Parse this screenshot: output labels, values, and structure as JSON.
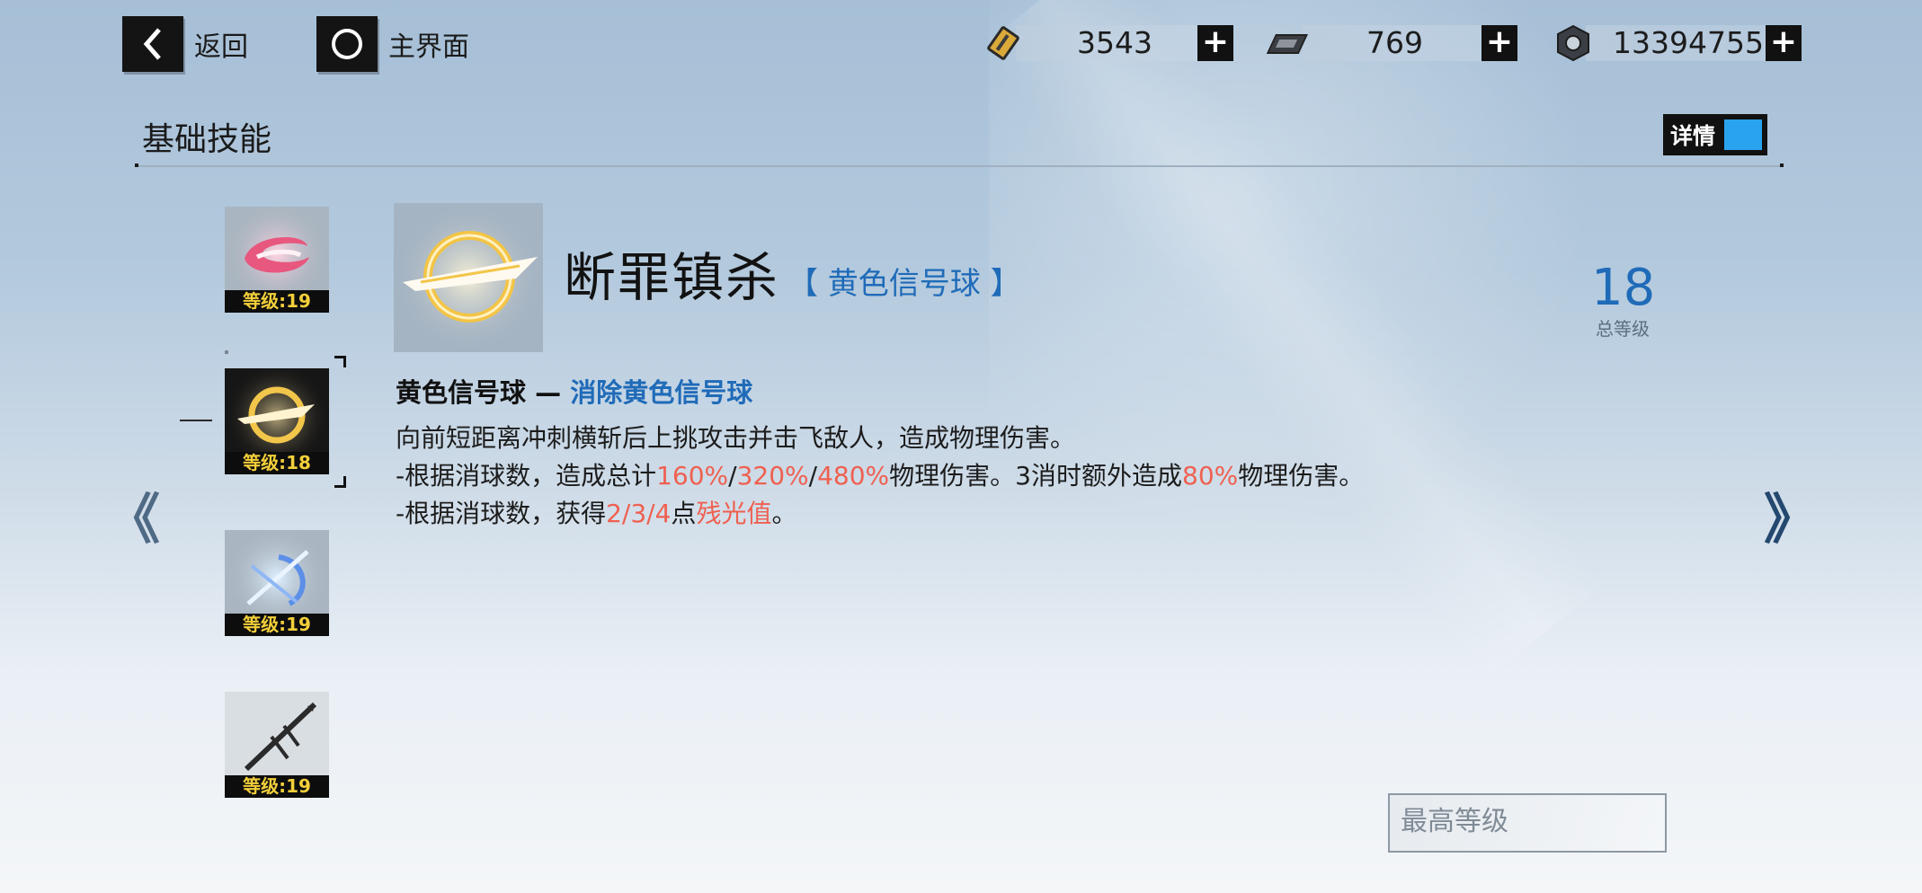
{
  "top_bar": {
    "back_label": "返回",
    "home_label": "主界面",
    "resources": [
      {
        "icon": "gold-card-icon",
        "value": "3543"
      },
      {
        "icon": "chip-icon",
        "value": "769"
      },
      {
        "icon": "hex-nut-icon",
        "value": "13394755"
      }
    ],
    "plus": "+"
  },
  "header": {
    "title": "基础技能",
    "toggle_label": "详情",
    "toggle_on": true,
    "accent": "#2aa3ee"
  },
  "skills": [
    {
      "icon": "pink-swirl-icon",
      "level": "等级:19"
    },
    {
      "icon": "golden-slash-ring-icon",
      "level": "等级:18",
      "selected": true
    },
    {
      "icon": "blue-spear-bow-icon",
      "level": "等级:19"
    },
    {
      "icon": "trident-spear-icon",
      "level": "等级:19"
    }
  ],
  "detail": {
    "name": "断罪镇杀",
    "tag": "【 黄色信号球 】",
    "total_level": "18",
    "total_level_label": "总等级",
    "head_prefix": "黄色信号球 — ",
    "head_highlight": "消除黄色信号球",
    "line1": "向前短距离冲刺横斩后上挑攻击并击飞敌人，造成物理伤害。",
    "line2": {
      "a": "-根据消球数，造成总计",
      "v1": "160%",
      "s1": "/",
      "v2": "320%",
      "s2": "/",
      "v3": "480%",
      "b": "物理伤害。3消时额外造成",
      "v4": "80%",
      "c": "物理伤害。"
    },
    "line3": {
      "a": " -根据消球数，获得",
      "v1": "2/3/4",
      "b": "点",
      "v2": "残光值",
      "c": "。"
    }
  },
  "footer": {
    "max_level_label": "最高等级"
  },
  "nav": {
    "prev": "《",
    "next": "》"
  },
  "colors": {
    "highlight_blue": "#1f6bb8",
    "value_red": "#ef6050",
    "level_yellow": "#f2cf3a"
  }
}
